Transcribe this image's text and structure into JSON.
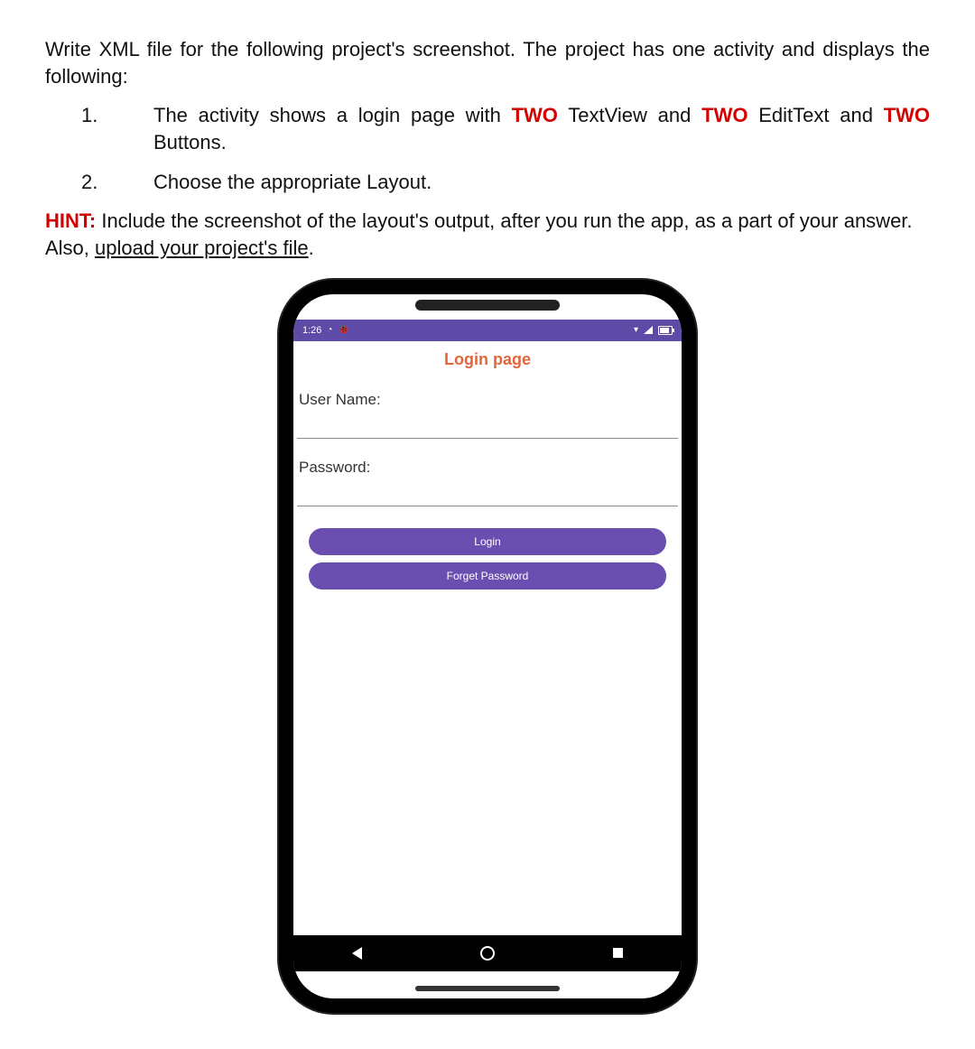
{
  "intro": "Write XML file for the following project's screenshot. The project has one activity and displays the following:",
  "list": {
    "item1": {
      "num": "1.",
      "part_a": "The activity shows a login page with ",
      "two1": "TWO",
      "part_b": " TextView and ",
      "two2": "TWO",
      "part_c": " EditText and ",
      "two3": "TWO",
      "part_d": " Buttons."
    },
    "item2": {
      "num": "2.",
      "text": "Choose the appropriate Layout."
    }
  },
  "hint": {
    "label": "HINT:",
    "part_a": " Include the screenshot of the layout's output, after you run the app, as a part of your answer. Also, ",
    "underline": "upload your project's file",
    "period": "."
  },
  "phone": {
    "time": "1:26",
    "title": "Login page",
    "labels": {
      "username": "User Name:",
      "password": "Password:"
    },
    "inputs": {
      "username": "",
      "password": ""
    },
    "buttons": {
      "login": "Login",
      "forgot": "Forget Password"
    }
  }
}
